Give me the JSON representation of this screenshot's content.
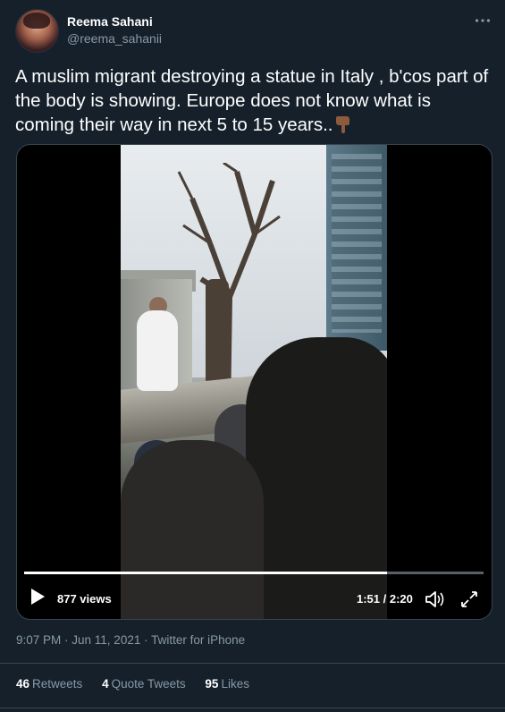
{
  "author": {
    "display_name": "Reema Sahani",
    "handle": "@reema_sahanii"
  },
  "tweet": {
    "text": "A muslim migrant destroying a statue in Italy , b'cos part of the body is showing. Europe does not know what is coming their way in next 5 to 15 years..",
    "emoji": "pointing-down-hand-emoji"
  },
  "video": {
    "views": "877 views",
    "time": "1:51 / 2:20",
    "progress_fraction": 0.79
  },
  "meta": {
    "timestamp": "9:07 PM · Jun 11, 2021 · Twitter for iPhone"
  },
  "stats": {
    "retweets_count": "46",
    "retweets_label": "Retweets",
    "quote_count": "4",
    "quote_label": "Quote Tweets",
    "likes_count": "95",
    "likes_label": "Likes"
  },
  "colors": {
    "background": "#15202b",
    "secondary_text": "#8899a6",
    "border": "#38444d"
  }
}
